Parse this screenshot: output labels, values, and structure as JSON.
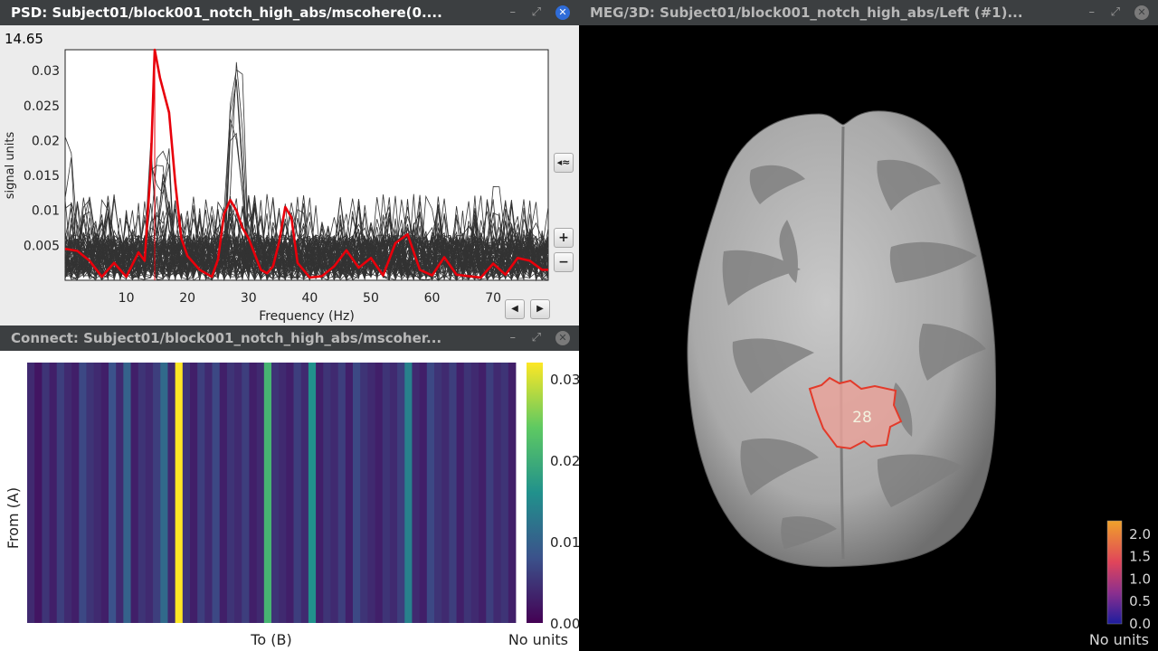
{
  "psd_window": {
    "title": "PSD: Subject01/block001_notch_high_abs/mscohere(0....",
    "cursor_value": "14.65",
    "buttons": {
      "minimize": "–",
      "restore": "⤢",
      "close": "✕",
      "zoom_in": "+",
      "zoom_out": "−",
      "prev": "◀",
      "next": "▶",
      "display_mode": "◂≈"
    }
  },
  "connect_window": {
    "title": "Connect: Subject01/block001_notch_high_abs/mscoher...",
    "x_label": "To (B)",
    "y_label": "From (A)",
    "units": "No units",
    "colorbar_ticks": [
      "0.03",
      "0.02",
      "0.01",
      "0.00"
    ]
  },
  "meg3d_window": {
    "title": "MEG/3D: Subject01/block001_notch_high_abs/Left (#1)...",
    "scout_label": "28",
    "units": "No units",
    "colorbar_ticks": [
      "2.0",
      "1.5",
      "1.0",
      "0.5",
      "0.0"
    ]
  },
  "chart_data": [
    {
      "type": "line",
      "title": "",
      "xlabel": "Frequency (Hz)",
      "ylabel": "signal units",
      "xlim": [
        0,
        79
      ],
      "ylim": [
        0,
        0.033
      ],
      "xticks": [
        10,
        20,
        30,
        40,
        50,
        60,
        70
      ],
      "yticks": [
        0.005,
        0.01,
        0.015,
        0.02,
        0.025,
        0.03
      ],
      "ytick_labels": [
        "0.005",
        "0.01",
        "0.015",
        "0.02",
        "0.025",
        "0.03"
      ],
      "cursor_x": 14.65,
      "highlight_color": "#e8000b",
      "background_color": "#333333",
      "series": [
        {
          "color": "#e8000b",
          "x": [
            0,
            2,
            4,
            6,
            8,
            10,
            12,
            13,
            14,
            14.65,
            15.5,
            17,
            18,
            19,
            20,
            22,
            24,
            25,
            26,
            27,
            28,
            29,
            30,
            32,
            33,
            34,
            35,
            36,
            37,
            38,
            40,
            42,
            44,
            46,
            48,
            50,
            52,
            54,
            56,
            58,
            60,
            62,
            64,
            66,
            68,
            70,
            72,
            74,
            76,
            78,
            79
          ],
          "y": [
            0.0045,
            0.0042,
            0.0028,
            0.0005,
            0.0025,
            0.0005,
            0.004,
            0.0028,
            0.016,
            0.033,
            0.029,
            0.024,
            0.014,
            0.006,
            0.0035,
            0.0015,
            0.0005,
            0.003,
            0.0095,
            0.0115,
            0.01,
            0.0075,
            0.006,
            0.0015,
            0.001,
            0.002,
            0.0055,
            0.0105,
            0.009,
            0.0025,
            0.0004,
            0.0006,
            0.002,
            0.0043,
            0.0018,
            0.0032,
            0.0007,
            0.0053,
            0.0066,
            0.0015,
            0.0007,
            0.0033,
            0.0008,
            0.0006,
            0.0004,
            0.0024,
            0.0008,
            0.0032,
            0.0028,
            0.0015,
            0.0015
          ]
        }
      ]
    },
    {
      "type": "heatmap",
      "xlabel": "To (B)",
      "ylabel": "From (A)",
      "units": "No units",
      "clim": [
        0,
        0.032
      ],
      "colormap": "viridis",
      "values": [
        0.004,
        0.002,
        0.005,
        0.003,
        0.006,
        0.004,
        0.003,
        0.007,
        0.005,
        0.004,
        0.003,
        0.008,
        0.004,
        0.01,
        0.003,
        0.005,
        0.004,
        0.006,
        0.011,
        0.004,
        0.032,
        0.005,
        0.003,
        0.006,
        0.004,
        0.007,
        0.003,
        0.005,
        0.004,
        0.006,
        0.003,
        0.004,
        0.021,
        0.005,
        0.004,
        0.003,
        0.006,
        0.004,
        0.016,
        0.003,
        0.005,
        0.004,
        0.006,
        0.003,
        0.007,
        0.005,
        0.004,
        0.003,
        0.005,
        0.004,
        0.006,
        0.014,
        0.004,
        0.003,
        0.007,
        0.005,
        0.004,
        0.006,
        0.003,
        0.005,
        0.004,
        0.003,
        0.006,
        0.004,
        0.005,
        0.003
      ]
    }
  ]
}
